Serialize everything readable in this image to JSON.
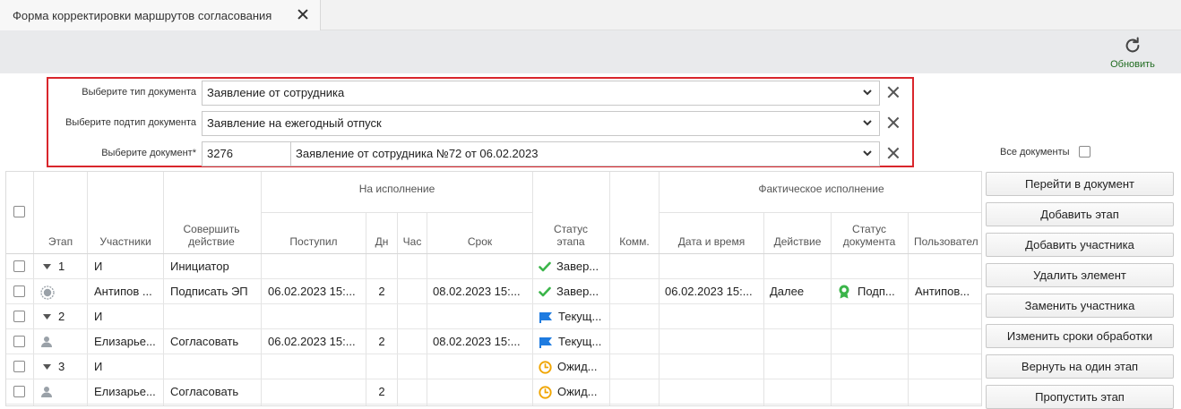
{
  "tab": {
    "title": "Форма корректировки маршрутов согласования"
  },
  "toolbar": {
    "refresh_label": "Обновить"
  },
  "filters": {
    "doc_type_label": "Выберите тип документа",
    "doc_type_value": "Заявление от сотрудника",
    "doc_subtype_label": "Выберите подтип документа",
    "doc_subtype_value": "Заявление на ежегодный отпуск",
    "document_label": "Выберите документ*",
    "document_number": "3276",
    "document_value": "Заявление от сотрудника №72 от 06.02.2023"
  },
  "all_docs_label": "Все документы",
  "table": {
    "group_headers": {
      "on_execution": "На исполнение",
      "actual_execution": "Фактическое исполнение"
    },
    "headers": {
      "stage": "Этап",
      "participants": "Участники",
      "action": "Совершить действие",
      "received": "Поступил",
      "days": "Дн",
      "hours": "Час",
      "deadline": "Срок",
      "stage_status": "Статус этапа",
      "comment": "Комм.",
      "datetime": "Дата и время",
      "actual_action": "Действие",
      "doc_status": "Статус документа",
      "user": "Пользовател"
    },
    "rows": [
      {
        "stage": "1",
        "participant": "И",
        "action": "Инициатор",
        "received": "",
        "days": "",
        "deadline": "",
        "status": "Завер...",
        "status_icon": "check-icon",
        "datetime": "",
        "act": "",
        "doc_status": "",
        "user": ""
      },
      {
        "stage": "",
        "participant": "Антипов ...",
        "action": "Подписать ЭП",
        "received": "06.02.2023 15:...",
        "days": "2",
        "deadline": "08.02.2023 15:...",
        "status": "Завер...",
        "status_icon": "check-icon",
        "datetime": "06.02.2023 15:...",
        "act": "Далее",
        "doc_status": "Подп...",
        "user": "Антипов..."
      },
      {
        "stage": "2",
        "participant": "И",
        "action": "",
        "received": "",
        "days": "",
        "deadline": "",
        "status": "Текущ...",
        "status_icon": "flag-icon",
        "datetime": "",
        "act": "",
        "doc_status": "",
        "user": ""
      },
      {
        "stage": "",
        "participant": "Елизарье...",
        "action": "Согласовать",
        "received": "06.02.2023 15:...",
        "days": "2",
        "deadline": "08.02.2023 15:...",
        "status": "Текущ...",
        "status_icon": "flag-icon",
        "datetime": "",
        "act": "",
        "doc_status": "",
        "user": ""
      },
      {
        "stage": "3",
        "participant": "И",
        "action": "",
        "received": "",
        "days": "",
        "deadline": "",
        "status": "Ожид...",
        "status_icon": "clock-icon",
        "datetime": "",
        "act": "",
        "doc_status": "",
        "user": ""
      },
      {
        "stage": "",
        "participant": "Елизарье...",
        "action": "Согласовать",
        "received": "",
        "days": "2",
        "deadline": "",
        "status": "Ожид...",
        "status_icon": "clock-icon",
        "datetime": "",
        "act": "",
        "doc_status": "",
        "user": ""
      }
    ]
  },
  "side_buttons": [
    "Перейти в документ",
    "Добавить этап",
    "Добавить участника",
    "Удалить элемент",
    "Заменить участника",
    "Изменить сроки обработки",
    "Вернуть на один этап",
    "Пропустить этап"
  ],
  "colors": {
    "accent_green": "#1f6b1f",
    "highlight_red": "#d9262c",
    "check_green": "#3bb54a",
    "flag_blue": "#1e7be0",
    "clock_orange": "#f0a500"
  }
}
